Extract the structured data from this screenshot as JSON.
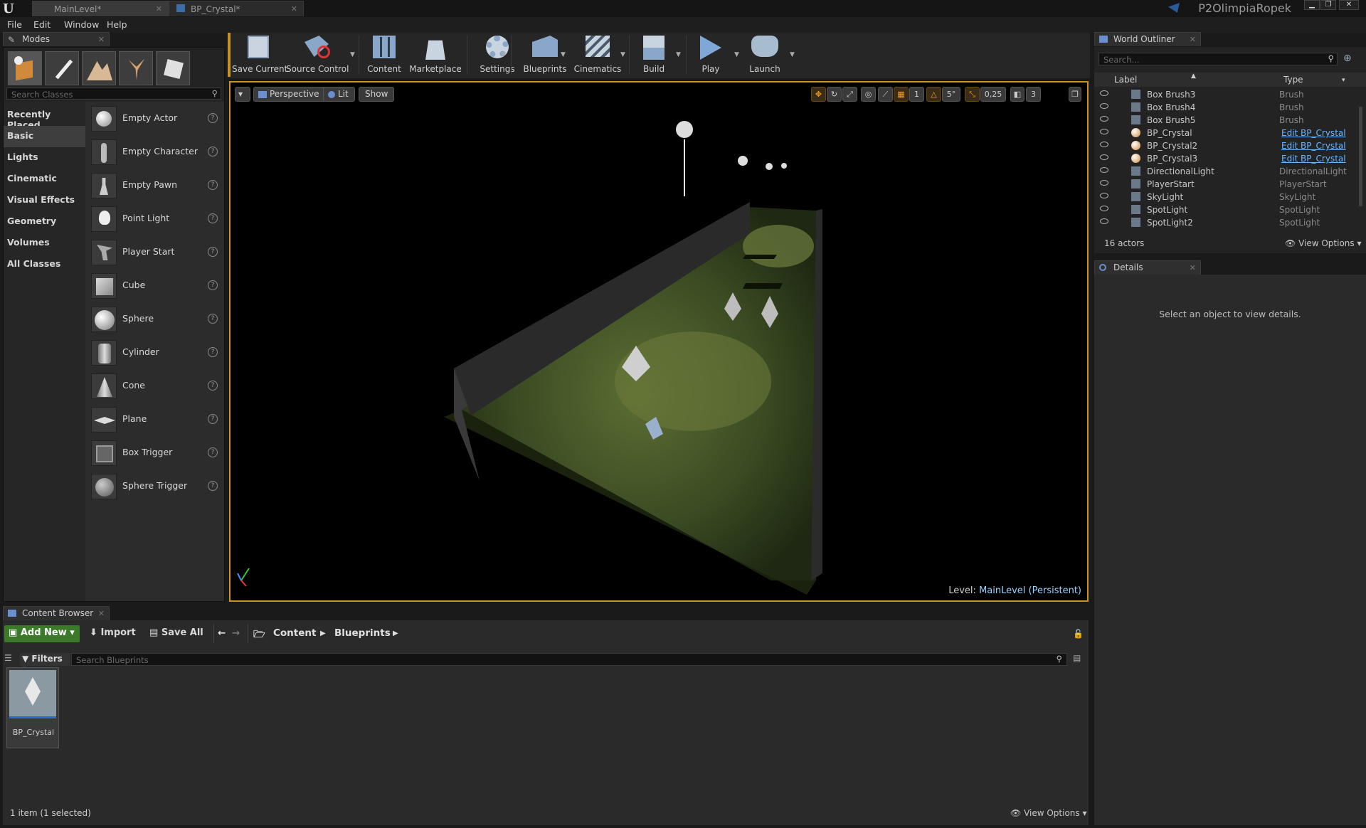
{
  "window": {
    "tabs": [
      {
        "label": "MainLevel*"
      },
      {
        "label": "BP_Crystal*"
      }
    ],
    "project_name": "P2OlimpiaRopek"
  },
  "menu": [
    "File",
    "Edit",
    "Window",
    "Help"
  ],
  "modes_panel": {
    "tab_label": "Modes",
    "search_placeholder": "Search Classes",
    "categories": [
      "Recently Placed",
      "Basic",
      "Lights",
      "Cinematic",
      "Visual Effects",
      "Geometry",
      "Volumes",
      "All Classes"
    ],
    "selected_category": "Basic",
    "items": [
      "Empty Actor",
      "Empty Character",
      "Empty Pawn",
      "Point Light",
      "Player Start",
      "Cube",
      "Sphere",
      "Cylinder",
      "Cone",
      "Plane",
      "Box Trigger",
      "Sphere Trigger"
    ]
  },
  "toolbar": {
    "buttons": [
      "Save Current",
      "Source Control",
      "Content",
      "Marketplace",
      "Settings",
      "Blueprints",
      "Cinematics",
      "Build",
      "Play",
      "Launch"
    ]
  },
  "viewport": {
    "perspective_label": "Perspective",
    "lit_label": "Lit",
    "show_label": "Show",
    "rotation_snap": "5°",
    "scale_snap": "0,25",
    "camera_speed": "3",
    "grid_snap": "1",
    "level_prefix": "Level:",
    "level_name": "MainLevel (Persistent)"
  },
  "outliner": {
    "tab_label": "World Outliner",
    "search_placeholder": "Search...",
    "col_label": "Label",
    "col_type": "Type",
    "rows": [
      {
        "label": "Box Brush3",
        "type": "Brush",
        "link": false
      },
      {
        "label": "Box Brush4",
        "type": "Brush",
        "link": false
      },
      {
        "label": "Box Brush5",
        "type": "Brush",
        "link": false
      },
      {
        "label": "BP_Crystal",
        "type": "Edit BP_Crystal",
        "link": true
      },
      {
        "label": "BP_Crystal2",
        "type": "Edit BP_Crystal",
        "link": true
      },
      {
        "label": "BP_Crystal3",
        "type": "Edit BP_Crystal",
        "link": true
      },
      {
        "label": "DirectionalLight",
        "type": "DirectionalLight",
        "link": false
      },
      {
        "label": "PlayerStart",
        "type": "PlayerStart",
        "link": false
      },
      {
        "label": "SkyLight",
        "type": "SkyLight",
        "link": false
      },
      {
        "label": "SpotLight",
        "type": "SpotLight",
        "link": false
      },
      {
        "label": "SpotLight2",
        "type": "SpotLight",
        "link": false
      }
    ],
    "actor_count": "16 actors",
    "view_options": "View Options"
  },
  "details": {
    "tab_label": "Details",
    "empty_message": "Select an object to view details."
  },
  "content_browser": {
    "tab_label": "Content Browser",
    "add_new": "Add New",
    "import": "Import",
    "save_all": "Save All",
    "breadcrumb": [
      "Content",
      "Blueprints"
    ],
    "filters": "Filters",
    "search_placeholder": "Search Blueprints",
    "assets": [
      {
        "name": "BP_Crystal"
      }
    ],
    "status": "1 item (1 selected)",
    "view_options": "View Options"
  }
}
